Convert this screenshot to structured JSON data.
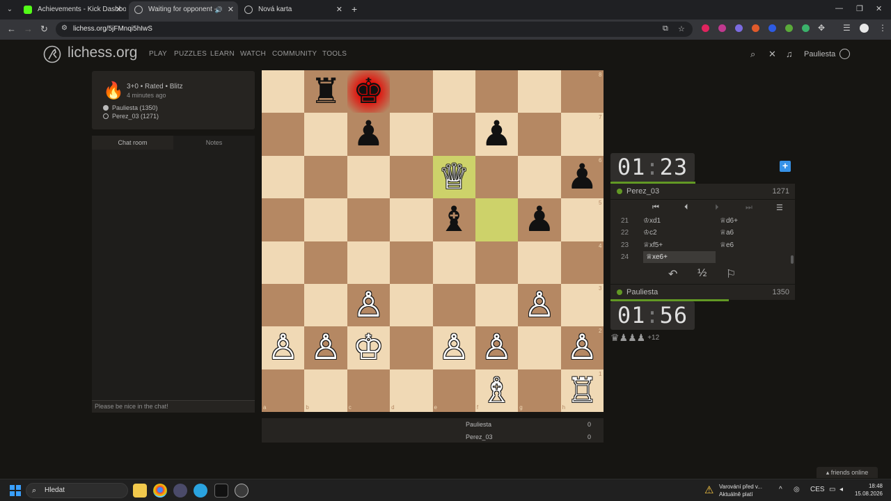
{
  "browser": {
    "tabs": [
      {
        "title": "Achievements - Kick Dashboard",
        "favicon_color": "#53fc18"
      },
      {
        "title": "Waiting for opponent - Play",
        "favicon_color": "#bababa"
      },
      {
        "title": "Nová karta",
        "favicon_color": "#bababa"
      }
    ],
    "url": "lichess.org/5jFMnqi5hIwS"
  },
  "header": {
    "logo": "lichess.org",
    "nav": [
      "PLAY",
      "PUZZLES",
      "LEARN",
      "WATCH",
      "COMMUNITY",
      "TOOLS"
    ],
    "username": "Pauliesta"
  },
  "game_meta": {
    "line1": "3+0 • Rated • Blitz",
    "line2": "4 minutes ago",
    "white_player": "Pauliesta (1350)",
    "black_player": "Perez_03 (1271)"
  },
  "chat": {
    "tab_chat": "Chat room",
    "tab_notes": "Notes",
    "placeholder": "Please be nice in the chat!"
  },
  "board": {
    "files": [
      "a",
      "b",
      "c",
      "d",
      "e",
      "f",
      "g",
      "h"
    ],
    "ranks": [
      "8",
      "7",
      "6",
      "5",
      "4",
      "3",
      "2",
      "1"
    ],
    "pieces": [
      {
        "sq": "b8",
        "glyph": "♜",
        "color": "b",
        "name": "black-rook"
      },
      {
        "sq": "c8",
        "glyph": "♚",
        "color": "b",
        "name": "black-king"
      },
      {
        "sq": "c7",
        "glyph": "♟",
        "color": "b",
        "name": "black-pawn"
      },
      {
        "sq": "f7",
        "glyph": "♟",
        "color": "b",
        "name": "black-pawn"
      },
      {
        "sq": "e6",
        "glyph": "♕",
        "color": "w",
        "name": "white-queen"
      },
      {
        "sq": "h6",
        "glyph": "♟",
        "color": "b",
        "name": "black-pawn"
      },
      {
        "sq": "e5",
        "glyph": "♝",
        "color": "b",
        "name": "black-bishop"
      },
      {
        "sq": "g5",
        "glyph": "♟",
        "color": "b",
        "name": "black-pawn"
      },
      {
        "sq": "c3",
        "glyph": "♙",
        "color": "w",
        "name": "white-pawn"
      },
      {
        "sq": "g3",
        "glyph": "♙",
        "color": "w",
        "name": "white-pawn"
      },
      {
        "sq": "a2",
        "glyph": "♙",
        "color": "w",
        "name": "white-pawn"
      },
      {
        "sq": "b2",
        "glyph": "♙",
        "color": "w",
        "name": "white-pawn"
      },
      {
        "sq": "c2",
        "glyph": "♔",
        "color": "w",
        "name": "white-king"
      },
      {
        "sq": "e2",
        "glyph": "♙",
        "color": "w",
        "name": "white-pawn"
      },
      {
        "sq": "f2",
        "glyph": "♙",
        "color": "w",
        "name": "white-pawn"
      },
      {
        "sq": "h2",
        "glyph": "♙",
        "color": "w",
        "name": "white-pawn"
      },
      {
        "sq": "f1",
        "glyph": "♗",
        "color": "w",
        "name": "white-bishop"
      },
      {
        "sq": "h1",
        "glyph": "♖",
        "color": "w",
        "name": "white-rook"
      }
    ],
    "last_move": [
      "f5",
      "e6"
    ],
    "check_square": "c8"
  },
  "underboard": {
    "rows": [
      {
        "name": "Pauliesta",
        "score": "0"
      },
      {
        "name": "Perez_03",
        "score": "0"
      }
    ]
  },
  "opponent": {
    "clock_min": "01",
    "clock_sec": "23",
    "name": "Perez_03",
    "rating": "1271",
    "time_fraction": 0.46
  },
  "me": {
    "clock_min": "01",
    "clock_sec": "56",
    "name": "Pauliesta",
    "rating": "1350",
    "time_fraction": 0.64,
    "material_glyphs": "♛♟♟♟",
    "material_diff": "+12"
  },
  "moves": [
    {
      "num": "21",
      "white": "♔xd1",
      "black": "♕d6+"
    },
    {
      "num": "22",
      "white": "♔c2",
      "black": "♕a6"
    },
    {
      "num": "23",
      "white": "♕xf5+",
      "black": "♕e6"
    },
    {
      "num": "24",
      "white": "♕xe6+",
      "black": ""
    }
  ],
  "game_controls": {
    "draw": "½"
  },
  "friends": "friends online",
  "taskbar": {
    "search": "Hledat",
    "warn_line1": "Varování před v...",
    "warn_line2": "Aktuálně platí",
    "lang": "CES",
    "time": "18:48",
    "date": "15.08.2026"
  }
}
